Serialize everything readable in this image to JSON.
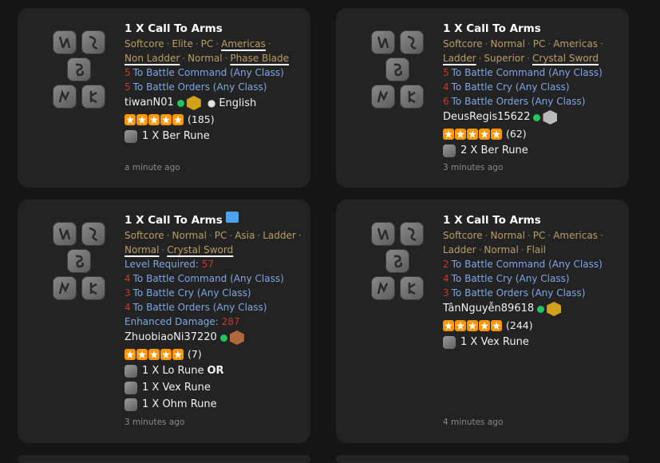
{
  "cards": [
    {
      "title": "1 X Call To Arms",
      "meta1": [
        "Softcore",
        "Elite",
        "PC",
        "Americas"
      ],
      "meta2": [
        "Non Ladder",
        "Normal",
        "Phase Blade"
      ],
      "lines": [
        {
          "num": "5",
          "text": "To Battle Command (Any Class)"
        },
        {
          "num": "5",
          "text": "To Battle Orders (Any Class)"
        }
      ],
      "user": "tiwanN01",
      "language": "English",
      "rating": "(185)",
      "offers": [
        "1 X Ber Rune"
      ],
      "time": "a minute ago"
    },
    {
      "title": "1 X Call To Arms",
      "meta1": [
        "Softcore",
        "Normal",
        "PC",
        "Americas"
      ],
      "meta2": [
        "Ladder",
        "Superior",
        "Crystal Sword"
      ],
      "lines": [
        {
          "num": "5",
          "text": "To Battle Command (Any Class)"
        },
        {
          "num": "4",
          "text": "To Battle Cry (Any Class)"
        },
        {
          "num": "6",
          "text": "To Battle Orders (Any Class)"
        }
      ],
      "user": "DeusRegis15622",
      "rating": "(62)",
      "offers": [
        "2 X Ber Rune"
      ],
      "time": "3 minutes ago"
    },
    {
      "title": "1 X Call To Arms",
      "meta1": [
        "Softcore",
        "Normal",
        "PC",
        "Asia",
        "Ladder"
      ],
      "meta2": [
        "Normal",
        "Crystal Sword"
      ],
      "level_label": "Level Required:",
      "level_value": "57",
      "lines": [
        {
          "num": "4",
          "text": "To Battle Command (Any Class)"
        },
        {
          "num": "3",
          "text": "To Battle Cry (Any Class)"
        },
        {
          "num": "4",
          "text": "To Battle Orders (Any Class)"
        }
      ],
      "enhanced_label": "Enhanced Damage:",
      "enhanced_value": "287",
      "user": "ZhuobiaoNi37220",
      "rating": "(7)",
      "offers": [
        "1 X Lo Rune",
        "1 X Vex Rune",
        "1 X Ohm Rune"
      ],
      "or_label": "OR",
      "time": "3 minutes ago"
    },
    {
      "title": "1 X Call To Arms",
      "meta1": [
        "Softcore",
        "Normal",
        "PC",
        "Americas"
      ],
      "meta2": [
        "Ladder",
        "Normal",
        "Flail"
      ],
      "lines": [
        {
          "num": "2",
          "text": "To Battle Command (Any Class)"
        },
        {
          "num": "4",
          "text": "To Battle Cry (Any Class)"
        },
        {
          "num": "3",
          "text": "To Battle Orders (Any Class)"
        }
      ],
      "user": "TânNguyễn89618",
      "rating": "(244)",
      "offers": [
        "1 X Vex Rune"
      ],
      "time": "4 minutes ago"
    }
  ],
  "colors": {
    "accent_meta": "#b99d67",
    "link_blue": "#7fa6e2",
    "red_num": "#c0392b",
    "online": "#22c55e",
    "star": "#ff9800"
  },
  "icons": {
    "rune": "rune-icon",
    "star": "star-icon",
    "chat": "chat-icon",
    "badge": "badge-icon"
  }
}
